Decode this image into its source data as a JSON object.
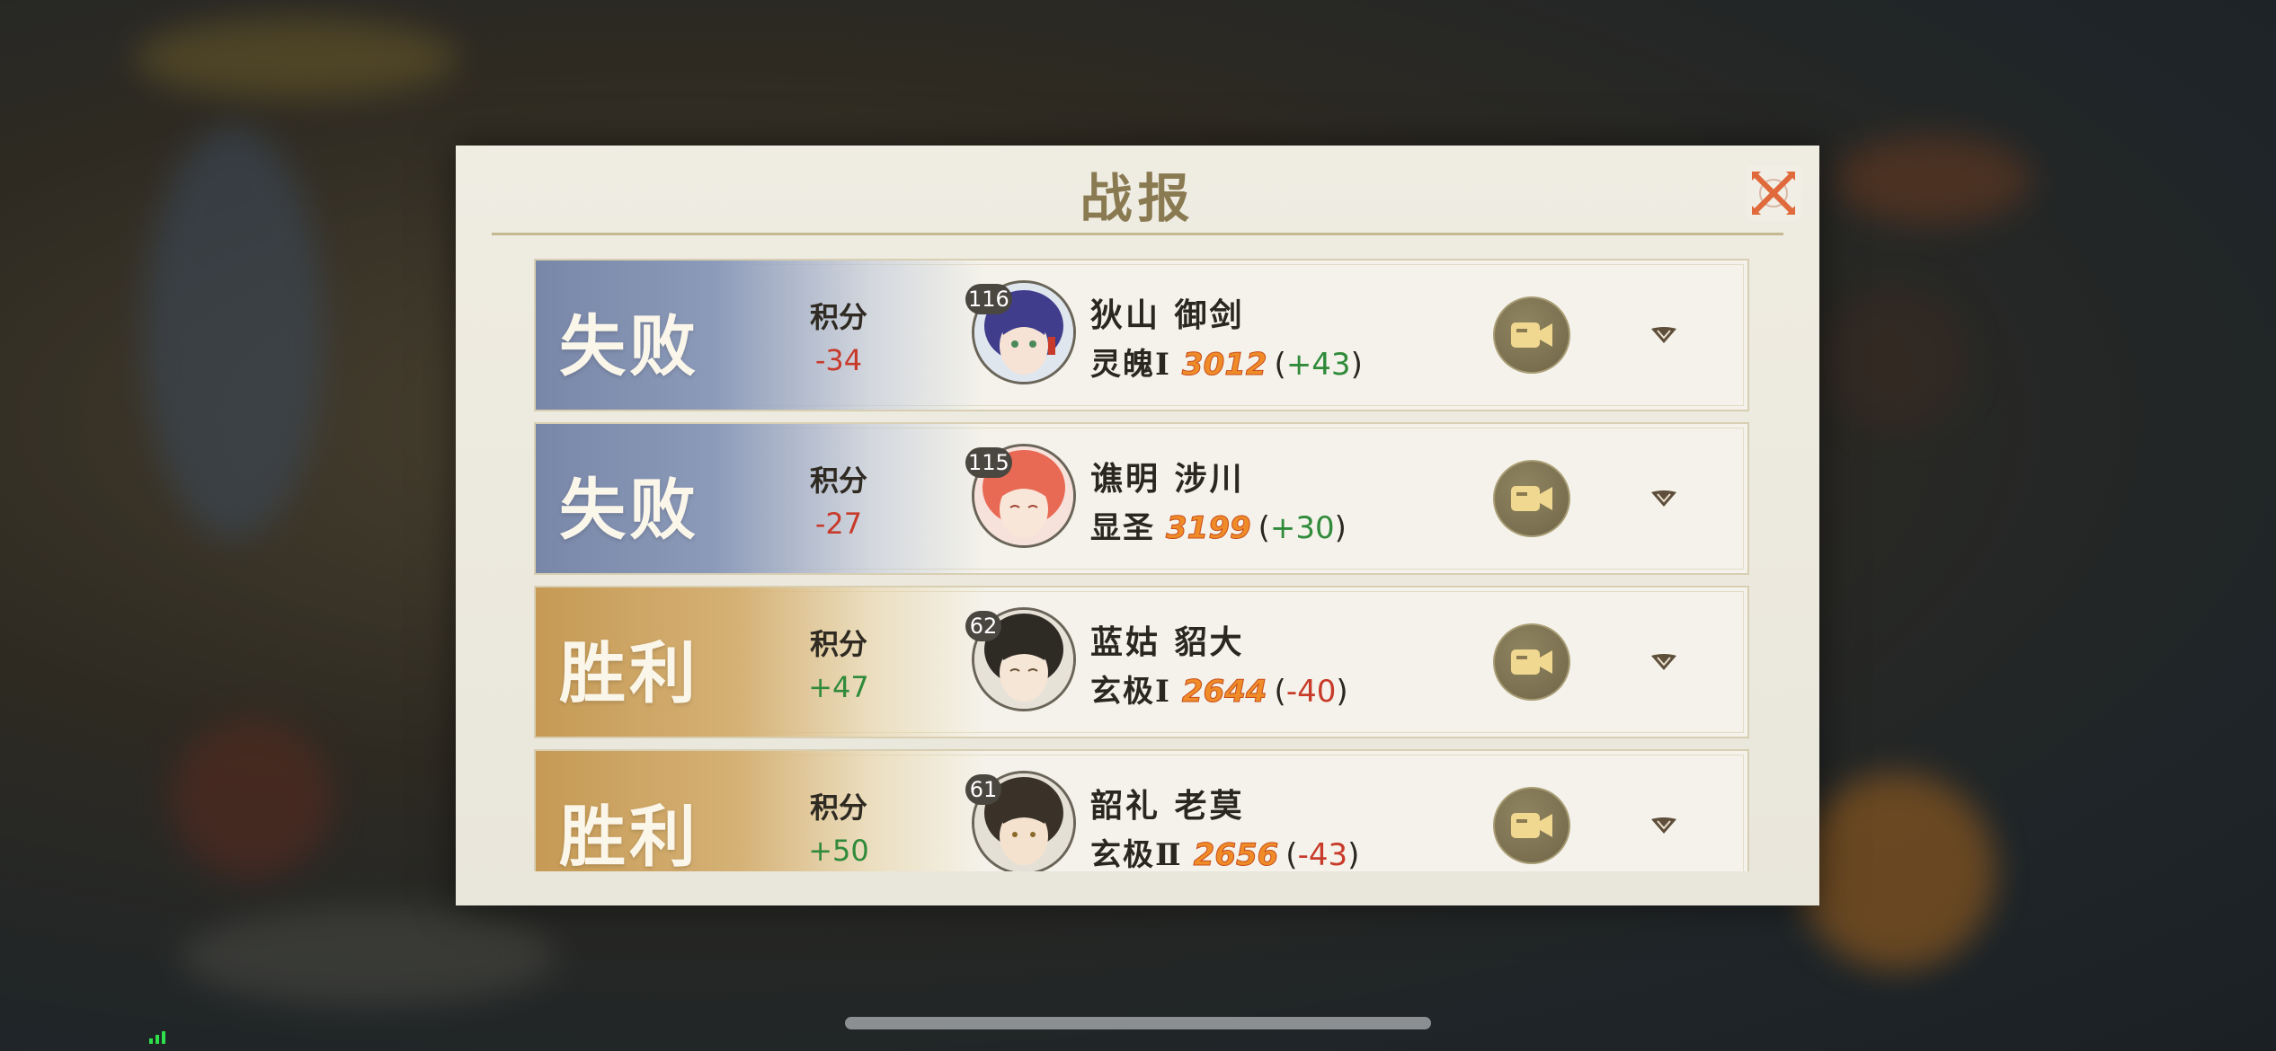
{
  "dialog": {
    "title": "战报"
  },
  "colors": {
    "loss_band": "#7886a8",
    "win_band": "#c69a55",
    "negative": "#c83a2a",
    "positive": "#2f8a3a",
    "rank_points": "#f08c28"
  },
  "records": [
    {
      "result": "失败",
      "outcome": "loss",
      "score_label": "积分",
      "score_delta": "-34",
      "level": "116",
      "name": "狄山 御剑",
      "rank": "灵魄Ⅰ",
      "rank_points": "3012",
      "rank_delta": "+43",
      "avatar_hair": "#3f3d8c",
      "avatar_skin": "#f6e3d6"
    },
    {
      "result": "失败",
      "outcome": "loss",
      "score_label": "积分",
      "score_delta": "-27",
      "level": "115",
      "name": "谯明 涉川",
      "rank": "显圣",
      "rank_points": "3199",
      "rank_delta": "+30",
      "avatar_hair": "#e86a55",
      "avatar_skin": "#f8e6d8"
    },
    {
      "result": "胜利",
      "outcome": "win",
      "score_label": "积分",
      "score_delta": "+47",
      "level": "62",
      "name": "蓝姑 貂大",
      "rank": "玄极Ⅰ",
      "rank_points": "2644",
      "rank_delta": "-40",
      "avatar_hair": "#2e2a24",
      "avatar_skin": "#f6e6d6"
    },
    {
      "result": "胜利",
      "outcome": "win",
      "score_label": "积分",
      "score_delta": "+50",
      "level": "61",
      "name": "韶礼 老莫",
      "rank": "玄极Ⅱ",
      "rank_points": "2656",
      "rank_delta": "-43",
      "avatar_hair": "#3a3228",
      "avatar_skin": "#f4e2cf"
    }
  ]
}
